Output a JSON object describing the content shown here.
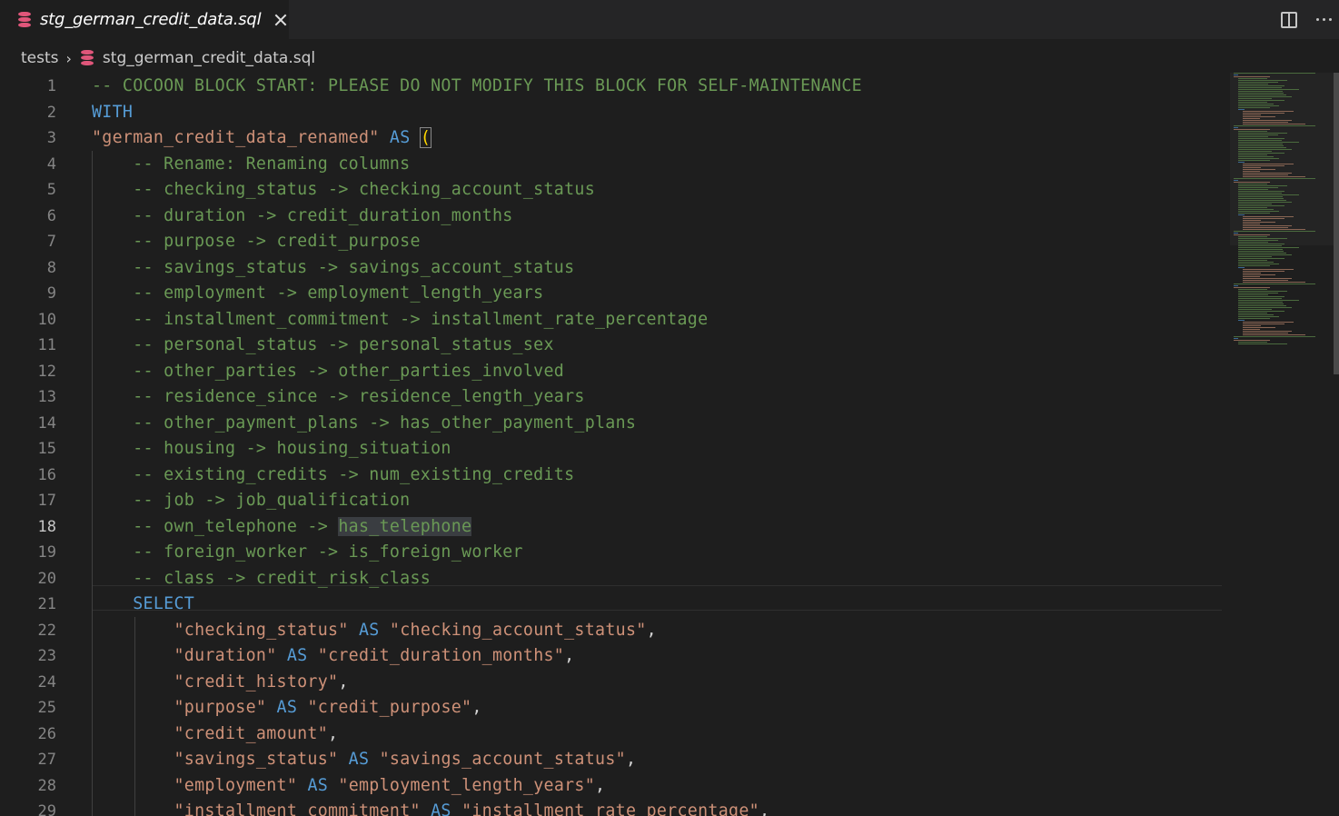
{
  "tab": {
    "label": "stg_german_credit_data.sql",
    "icon": "database-icon"
  },
  "breadcrumb": {
    "folder": "tests",
    "file": "stg_german_credit_data.sql"
  },
  "editor": {
    "current_line": 18,
    "lines": [
      {
        "n": "1",
        "code": "-- COCOON BLOCK START: PLEASE DO NOT MODIFY THIS BLOCK FOR SELF-MAINTENANCE"
      },
      {
        "n": "2",
        "code": "WITH"
      },
      {
        "n": "3",
        "code": "\"german_credit_data_renamed\" AS ("
      },
      {
        "n": "4",
        "code": "    -- Rename: Renaming columns"
      },
      {
        "n": "5",
        "code": "    -- checking_status -> checking_account_status"
      },
      {
        "n": "6",
        "code": "    -- duration -> credit_duration_months"
      },
      {
        "n": "7",
        "code": "    -- purpose -> credit_purpose"
      },
      {
        "n": "8",
        "code": "    -- savings_status -> savings_account_status"
      },
      {
        "n": "9",
        "code": "    -- employment -> employment_length_years"
      },
      {
        "n": "10",
        "code": "    -- installment_commitment -> installment_rate_percentage"
      },
      {
        "n": "11",
        "code": "    -- personal_status -> personal_status_sex"
      },
      {
        "n": "12",
        "code": "    -- other_parties -> other_parties_involved"
      },
      {
        "n": "13",
        "code": "    -- residence_since -> residence_length_years"
      },
      {
        "n": "14",
        "code": "    -- other_payment_plans -> has_other_payment_plans"
      },
      {
        "n": "15",
        "code": "    -- housing -> housing_situation"
      },
      {
        "n": "16",
        "code": "    -- existing_credits -> num_existing_credits"
      },
      {
        "n": "17",
        "code": "    -- job -> job_qualification"
      },
      {
        "n": "18",
        "code": "    -- own_telephone -> has_telephone"
      },
      {
        "n": "19",
        "code": "    -- foreign_worker -> is_foreign_worker"
      },
      {
        "n": "20",
        "code": "    -- class -> credit_risk_class"
      },
      {
        "n": "21",
        "code": "    SELECT"
      },
      {
        "n": "22",
        "code": "        \"checking_status\" AS \"checking_account_status\","
      },
      {
        "n": "23",
        "code": "        \"duration\" AS \"credit_duration_months\","
      },
      {
        "n": "24",
        "code": "        \"credit_history\","
      },
      {
        "n": "25",
        "code": "        \"purpose\" AS \"credit_purpose\","
      },
      {
        "n": "26",
        "code": "        \"credit_amount\","
      },
      {
        "n": "27",
        "code": "        \"savings_status\" AS \"savings_account_status\","
      },
      {
        "n": "28",
        "code": "        \"employment\" AS \"employment_length_years\","
      },
      {
        "n": "29",
        "code": "        \"installment_commitment\" AS \"installment_rate_percentage\","
      }
    ]
  },
  "colors": {
    "background": "#1e1e1e",
    "comment": "#6a9955",
    "keyword": "#569cd6",
    "string": "#ce9178",
    "line_number": "#858585",
    "db_icon": "#e0567a"
  },
  "icons": [
    "database-icon",
    "close-icon",
    "split-editor-icon",
    "more-actions-icon",
    "chevron-right-icon"
  ]
}
